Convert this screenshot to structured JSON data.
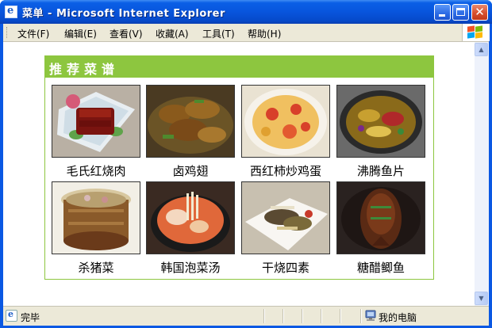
{
  "window": {
    "title": "菜单 - Microsoft Internet Explorer",
    "icon": "ie-page-icon",
    "controls": [
      "minimize-icon",
      "maximize-icon",
      "close-icon"
    ]
  },
  "menubar": {
    "items": [
      {
        "label": "文件(F)"
      },
      {
        "label": "编辑(E)"
      },
      {
        "label": "查看(V)"
      },
      {
        "label": "收藏(A)"
      },
      {
        "label": "工具(T)"
      },
      {
        "label": "帮助(H)"
      }
    ]
  },
  "panel": {
    "title": "推荐菜谱",
    "header_color": "#8dc63f",
    "dishes": [
      {
        "name": "毛氏红烧肉"
      },
      {
        "name": "卤鸡翅"
      },
      {
        "name": "西红柿炒鸡蛋"
      },
      {
        "name": "沸腾鱼片"
      },
      {
        "name": "杀猪菜"
      },
      {
        "name": "韩国泡菜汤"
      },
      {
        "name": "干烧四素"
      },
      {
        "name": "糖醋鲫鱼"
      }
    ]
  },
  "statusbar": {
    "status": "完毕",
    "zone": "我的电脑"
  },
  "colors": {
    "titlebar": "#0855dd",
    "chrome": "#ece9d8",
    "accent_green": "#8dc63f"
  }
}
